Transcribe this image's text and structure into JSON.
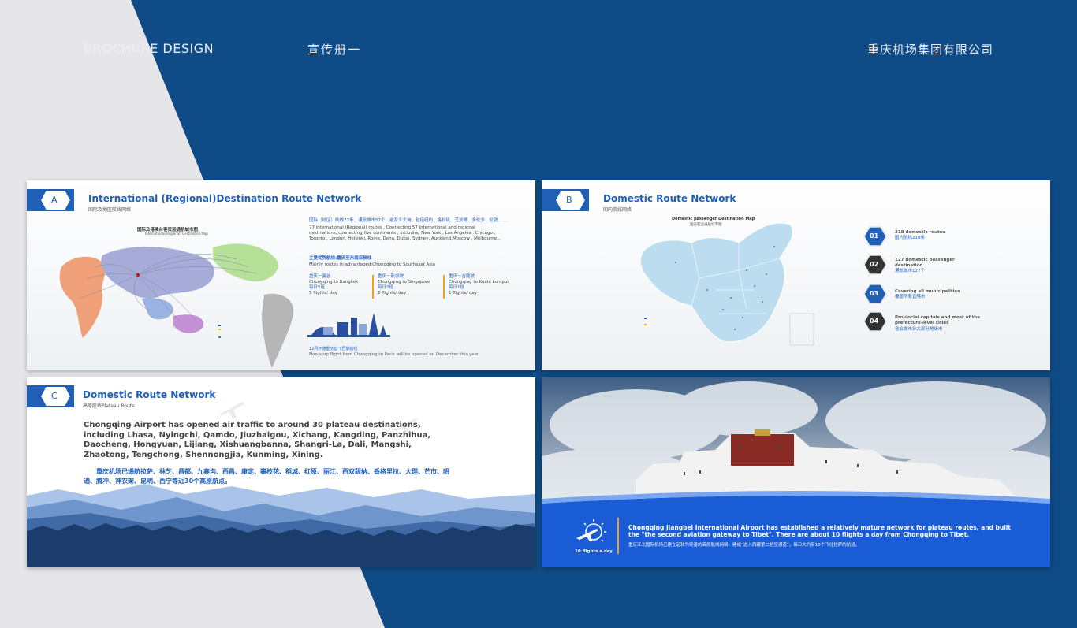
{
  "header": {
    "left_title": "BROCHURE DESIGN",
    "center_title": "宣传册一",
    "right_title": "重庆机场集团有限公司"
  },
  "slideA": {
    "badge": "A",
    "title": "International (Regional)Destination Route Network",
    "subtitle": "国际及地区航线网络",
    "map_title": "国际及港澳台客货运通航城市图",
    "map_subtitle": "International(Regional) Destination Map",
    "cn_intro": "国际（地区）航线77条，通航城市57个，遍及五大洲，包括纽约、洛杉矶、芝加哥、多伦多、伦敦……",
    "intro": "77 international (Regional) routes , Connecting 57 international and regional destinations, connecting five continents , including New York , Los Angeles , Chicago , Toronto , London, Helsinki, Rome, Doha, Dubai, Sydney, Auckland,Moscow , Melbourne...",
    "adv_cn": "主要优势航线:重庆至东南亚航线",
    "adv_en": "Mainly routes in advantaged:Chongqing to Southeast Asia",
    "routes": [
      {
        "cn": "重庆－曼谷",
        "en": "Chongqing to Bangkok",
        "cn2": "每日5班",
        "freq": "5 flights/ day"
      },
      {
        "cn": "重庆－新加坡",
        "en": "Chongqing to Singapore",
        "cn2": "每日2班",
        "freq": "2 flights/ day"
      },
      {
        "cn": "重庆－吉隆坡",
        "en": "Chongqing to Kuala Lumpur",
        "cn2": "每日1班",
        "freq": "1 flights/ day"
      }
    ],
    "paris_cn": "12月开通重庆直飞巴黎航线",
    "paris_en": "Non-stop flight from Chongqing to Paris will be opened on December this year."
  },
  "slideB": {
    "badge": "B",
    "title": "Domestic Route Network",
    "subtitle": "国内航线网络",
    "map_title": "Domestic passenger Destination Map",
    "map_subtitle": "国内客运通航城市图",
    "stats": [
      {
        "num": "01",
        "en": "218 domestic routes",
        "cn": "国内航线218条"
      },
      {
        "num": "02",
        "en": "127 domestic passenger destination",
        "cn": "通航城市127个"
      },
      {
        "num": "03",
        "en": "Covering all municipalities",
        "cn": "覆盖所有直辖市"
      },
      {
        "num": "04",
        "en": "Provincial capitals and most of the prefecture-level cities",
        "cn": "省会城市及大部分地级市"
      }
    ]
  },
  "slideC": {
    "badge": "C",
    "title": "Domestic Route Network",
    "subtitle": "高原航线Plateau Route",
    "body_en": "Chongqing Airport has opened air traffic to around 30 plateau destinations, including Lhasa, Nyingchi, Qamdo, Jiuzhaigou, Xichang, Kangding, Panzhihua, Daocheng, Hongyuan, Lijiang, Xishuangbanna, Shangri-La, Dali, Mangshi, Zhaotong, Tengchong, Shennongjia, Kunming, Xining.",
    "body_cn": "重庆机场已通航拉萨、林芝、昌都、九寨沟、西昌、康定、攀枝花、稻城、红原、丽江、西双版纳、香格里拉、大理、芒市、昭通、腾冲、神农架、昆明、西宁等近30个高原航点。"
  },
  "slideD": {
    "icon_label": "10 flights a day",
    "body_en": "Chongqing Jiangbei International Airport has established a relatively mature network for plateau routes, and built the \"the second aviation gateway to Tibet\". There are about 10 flights a day from Chongqing to Tibet.",
    "body_cn": "重庆江北国际机场已建立起较为完善的高原航线网络，建成“进入西藏第二航空通道”，每日大约有10个飞往拉萨的航班。"
  },
  "colors": {
    "background_blue": "#0f4b86",
    "accent_blue": "#1f5fb5",
    "light_grey": "#e6e6e8"
  }
}
